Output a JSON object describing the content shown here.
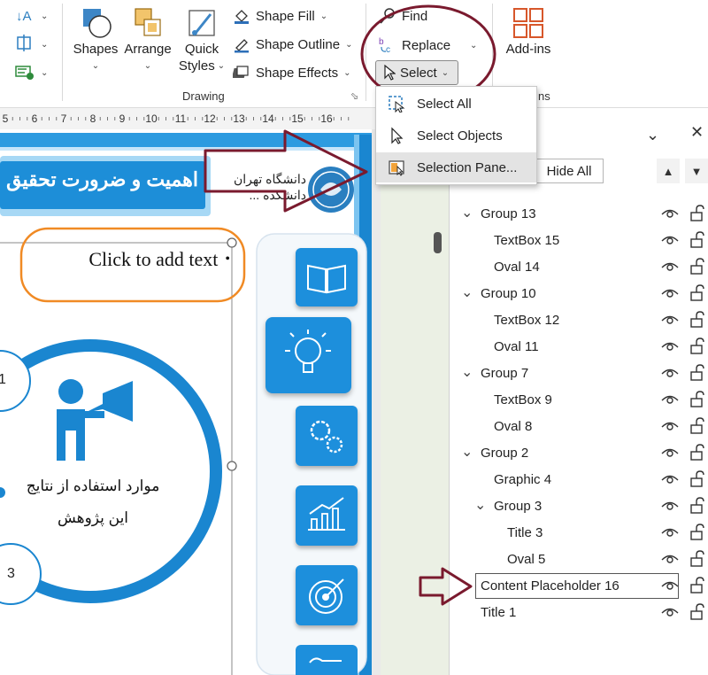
{
  "ribbon": {
    "shapes_label": "Shapes",
    "arrange_label": "Arrange",
    "quick_styles_line1": "Quick",
    "quick_styles_line2": "Styles",
    "shape_fill": "Shape Fill",
    "shape_outline": "Shape Outline",
    "shape_effects": "Shape Effects",
    "drawing_group": "Drawing",
    "find": "Find",
    "replace": "Replace",
    "select": "Select",
    "addins": "Add-ins",
    "addins_group_partial": "ns"
  },
  "select_menu": {
    "items": [
      {
        "label": "Select All",
        "icon": "select-all-icon"
      },
      {
        "label": "Select Objects",
        "icon": "cursor-icon"
      },
      {
        "label": "Selection Pane...",
        "icon": "selection-pane-icon"
      }
    ]
  },
  "ruler": {
    "ticks": [
      "5",
      "6",
      "7",
      "8",
      "9",
      "10",
      "11",
      "12",
      "13",
      "14",
      "15",
      "16"
    ]
  },
  "slide": {
    "header_title": "اهمیت و ضرورت تحقیق",
    "university": "دانشگاه تهران",
    "faculty": "دانشکده ...",
    "placeholder_text": "Click to add text",
    "circle_text_line1": "موارد استفاده از نتایج",
    "circle_text_line2": "این پژوهش",
    "num_1": "1",
    "num_3": "3"
  },
  "selection_pane": {
    "hide_all": "Hide All",
    "items": [
      {
        "label": "Group 13",
        "level": 0,
        "expandable": true
      },
      {
        "label": "TextBox 15",
        "level": 1
      },
      {
        "label": "Oval 14",
        "level": 1
      },
      {
        "label": "Group 10",
        "level": 0,
        "expandable": true
      },
      {
        "label": "TextBox 12",
        "level": 1
      },
      {
        "label": "Oval 11",
        "level": 1
      },
      {
        "label": "Group 7",
        "level": 0,
        "expandable": true
      },
      {
        "label": "TextBox 9",
        "level": 1
      },
      {
        "label": "Oval 8",
        "level": 1
      },
      {
        "label": "Group 2",
        "level": 0,
        "expandable": true
      },
      {
        "label": "Graphic 4",
        "level": 1
      },
      {
        "label": "Group 3",
        "level": 1,
        "expandable": true
      },
      {
        "label": "Title 3",
        "level": 2
      },
      {
        "label": "Oval 5",
        "level": 2
      },
      {
        "label": "Content Placeholder 16",
        "level": 0,
        "selected": true
      },
      {
        "label": "Title 1",
        "level": 0
      }
    ]
  },
  "colors": {
    "annotation_maroon": "#7a1a2e",
    "slide_blue": "#1a86d0",
    "placeholder_orange": "#f08a24"
  }
}
